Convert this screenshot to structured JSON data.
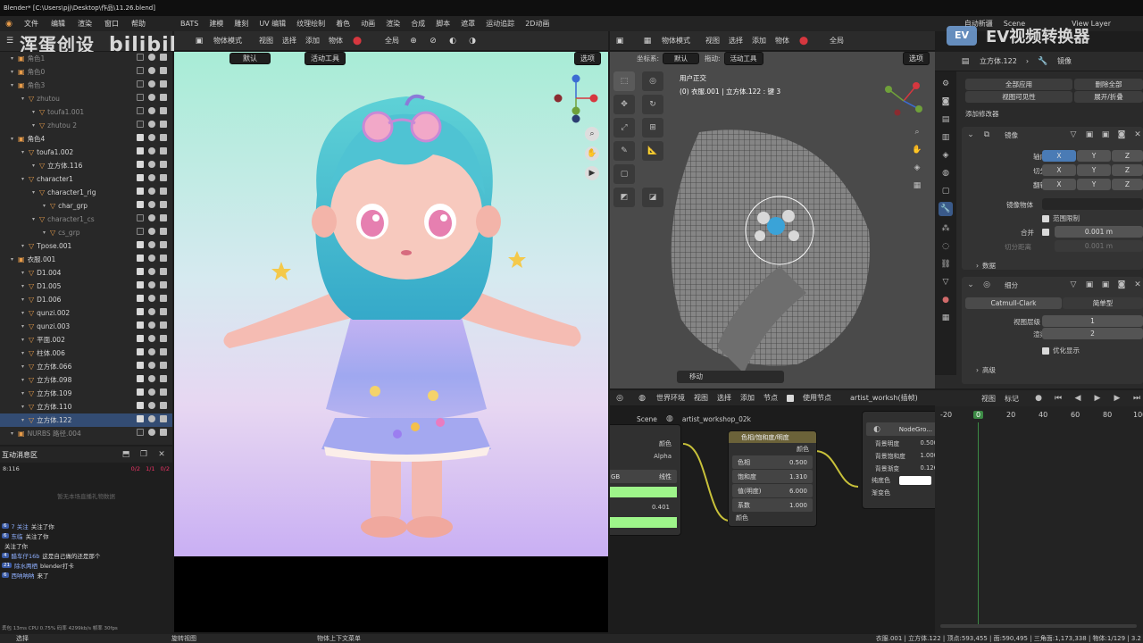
{
  "titlebar": {
    "text": "Blender* [C:\\Users\\pjj\\Desktop\\作品\\11.26.blend]"
  },
  "menubar": {
    "items": [
      "文件",
      "编辑",
      "渲染",
      "窗口",
      "帮助"
    ],
    "workspaces": [
      "BATS",
      "建模",
      "雕刻",
      "UV 编辑",
      "纹理绘制",
      "着色",
      "动画",
      "渲染",
      "合成",
      "脚本",
      "遮罩",
      "运动追踪",
      "2D动画"
    ],
    "auto_save": "自动新疆",
    "scene": "Scene",
    "view_layer": "View Layer"
  },
  "watermark": {
    "left": "浑蛋创设",
    "right": "EV视频转换器"
  },
  "outliner": {
    "items": [
      {
        "label": "角色1",
        "depth": 1,
        "dim": true
      },
      {
        "label": "角色0",
        "depth": 1,
        "dim": true
      },
      {
        "label": "角色3",
        "depth": 1,
        "dim": true
      },
      {
        "label": "zhutou",
        "depth": 2,
        "dim": true
      },
      {
        "label": "toufa1.001",
        "depth": 3,
        "dim": true
      },
      {
        "label": "zhutou 2",
        "depth": 3,
        "dim": true
      },
      {
        "label": "角色4",
        "depth": 1
      },
      {
        "label": "toufa1.002",
        "depth": 2
      },
      {
        "label": "立方体.116",
        "depth": 3
      },
      {
        "label": "character1",
        "depth": 2
      },
      {
        "label": "character1_rig",
        "depth": 3
      },
      {
        "label": "char_grp",
        "depth": 4
      },
      {
        "label": "character1_cs",
        "depth": 3,
        "dim": true
      },
      {
        "label": "cs_grp",
        "depth": 4,
        "dim": true
      },
      {
        "label": "Tpose.001",
        "depth": 2
      },
      {
        "label": "衣服.001",
        "depth": 1
      },
      {
        "label": "D1.004",
        "depth": 2
      },
      {
        "label": "D1.005",
        "depth": 2
      },
      {
        "label": "D1.006",
        "depth": 2
      },
      {
        "label": "qunzi.002",
        "depth": 2
      },
      {
        "label": "qunzi.003",
        "depth": 2
      },
      {
        "label": "平面.002",
        "depth": 2
      },
      {
        "label": "柱体.006",
        "depth": 2
      },
      {
        "label": "立方体.066",
        "depth": 2
      },
      {
        "label": "立方体.098",
        "depth": 2
      },
      {
        "label": "立方体.109",
        "depth": 2
      },
      {
        "label": "立方体.110",
        "depth": 2
      },
      {
        "label": "立方体.122",
        "depth": 2,
        "sel": true
      },
      {
        "label": "NURBS 路径.004",
        "depth": 1,
        "dim": true
      }
    ]
  },
  "chat": {
    "title": "互动消息区",
    "count": "8:116",
    "stats": [
      "0/2",
      "1/1",
      "0/2"
    ],
    "empty": "暂无本场直播礼物数据",
    "lines": [
      {
        "badge": "6",
        "name": "7 关注",
        "text": "关注了你"
      },
      {
        "badge": "6",
        "name": "东临",
        "text": "关注了你"
      },
      {
        "badge": "",
        "name": "",
        "text": "关注了你"
      },
      {
        "badge": "4",
        "name": "醋车仔16b",
        "text": "这是自己做的还是那个"
      },
      {
        "badge": "21",
        "name": "除水两栖",
        "text": "blender打卡"
      },
      {
        "badge": "6",
        "name": "西呐呐呐",
        "text": "来了"
      }
    ],
    "footer": "丢包 13ms  CPU 0.75%  码率 4299kb/s  帧率 30fps"
  },
  "vp1": {
    "mode": "物体模式",
    "menus": [
      "视图",
      "选择",
      "添加",
      "物体"
    ],
    "global": "全局",
    "slot": "默认",
    "tool": "活动工具",
    "options": "选项"
  },
  "vp2": {
    "mode": "物体模式",
    "menus": [
      "视图",
      "选择",
      "添加",
      "物体"
    ],
    "global": "全局",
    "coord_label": "坐标系:",
    "coord": "默认",
    "drag_label": "拖动:",
    "tool": "活动工具",
    "options": "选项",
    "view_name": "用户正交",
    "view_obj": "(0) 衣服.001 | 立方体.122 : 键 3",
    "move_label": "移动"
  },
  "node": {
    "header": [
      "世界环境",
      "视图",
      "选择",
      "添加",
      "节点",
      "使用节点"
    ],
    "material": "artist_worksh(插帧)",
    "breadcrumb": [
      "Scene",
      "artist_workshop_02k"
    ],
    "hsv": {
      "title": "色相/饱和度/明度",
      "out": "颜色",
      "fields": [
        {
          "k": "色相",
          "v": "0.500"
        },
        {
          "k": "饱和度",
          "v": "1.310"
        },
        {
          "k": "值(明度)",
          "v": "6.000"
        },
        {
          "k": "系数",
          "v": "1.000"
        }
      ],
      "in": "颜色"
    },
    "left": {
      "out1": "颜色",
      "out2": "Alpha",
      "mode": "线性",
      "value": "0.401"
    },
    "group": {
      "title": "NodeGro...",
      "fields": [
        {
          "k": "背景明度",
          "v": "0.500"
        },
        {
          "k": "背景饱和度",
          "v": "1.000"
        },
        {
          "k": "背景渐变",
          "v": "0.126"
        }
      ],
      "in1": "纯底色",
      "in2": "渐变色"
    }
  },
  "props": {
    "breadcrumb": [
      "立方体.122",
      "镜像"
    ],
    "apply_all": "全部应用",
    "delete_all": "删除全部",
    "viewport_vis": "视图可见性",
    "expand": "展开/折叠",
    "add_modifier": "添加修改器",
    "mirror": {
      "name": "镜像",
      "axis_label": "轴向",
      "bisect_label": "切分",
      "flip_label": "翻转",
      "axes": [
        "X",
        "Y",
        "Z"
      ],
      "mirror_obj": "镜像物体",
      "clip": "范围限制",
      "merge_label": "合并",
      "merge_val": "0.001 m",
      "bisect_dist": "切分距离",
      "bisect_val": "0.001 m",
      "data": "数据"
    },
    "subsurf": {
      "name": "细分",
      "catmull": "Catmull-Clark",
      "simple": "简单型",
      "levels_label": "视图层级",
      "levels": "1",
      "render_label": "渲染",
      "render": "2",
      "optimal": "优化显示",
      "advanced": "高级"
    }
  },
  "timeline": {
    "header": [
      "视图",
      "标记"
    ],
    "current": "0",
    "ticks": [
      "-20",
      "0",
      "20",
      "40",
      "60",
      "80",
      "100"
    ]
  },
  "status": {
    "left": "选择",
    "mid1": "旋转视图",
    "mid2": "物体上下文菜单",
    "right": "衣服.001 | 立方体.122 | 顶点:593,455 | 面:590,495 | 三角面:1,173,338 | 物体:1/129 | 3.2"
  },
  "colors": {
    "accent": "#e89c4a",
    "select": "#334c73",
    "axis_x": "#d6373f",
    "axis_y": "#6fa03a",
    "axis_z": "#3b6bd3",
    "node_green": "#9ef58a"
  }
}
